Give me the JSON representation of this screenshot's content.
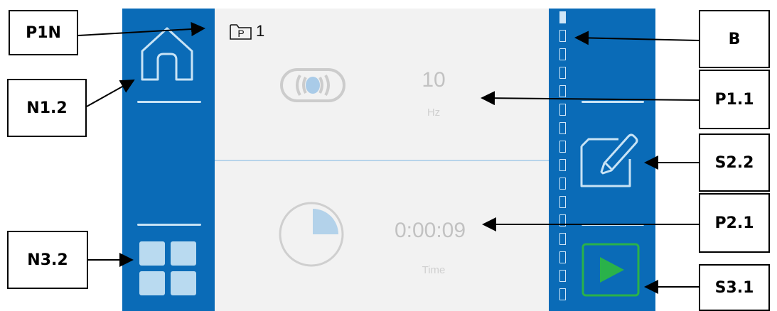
{
  "callouts": {
    "p1n": "P1N",
    "n1_2": "N1.2",
    "n3_2": "N3.2",
    "b": "B",
    "p1_1": "P1.1",
    "s2_2": "S2.2",
    "p2_1": "P2.1",
    "s3_1": "S3.1"
  },
  "program": {
    "icon_letter": "P",
    "number": "1"
  },
  "frequency": {
    "value": "10",
    "unit": "Hz"
  },
  "timer": {
    "value": "0:00:09",
    "unit": "Time"
  },
  "scroll": {
    "segments": 16,
    "active_index": 0
  },
  "icons": {
    "home": "home-icon",
    "grid": "grid-icon",
    "edit": "edit-icon",
    "play": "play-icon",
    "vibration": "vibration-icon",
    "timer": "timer-icon",
    "program_folder": "folder-icon"
  },
  "colors": {
    "bar_blue": "#0a6bb7",
    "screen_bg": "#f2f2f2",
    "play_green": "#2ab24a",
    "light_blue": "#c8e3f5"
  }
}
